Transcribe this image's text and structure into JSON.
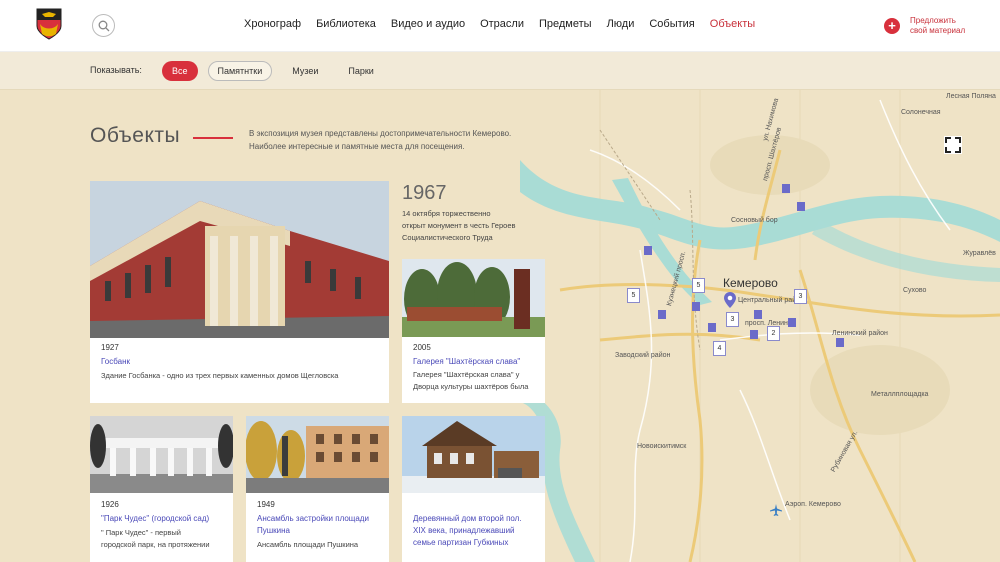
{
  "header": {
    "nav": [
      "Хронограф",
      "Библиотека",
      "Видео и аудио",
      "Отрасли",
      "Предметы",
      "Люди",
      "События",
      "Объекты"
    ],
    "active_nav": "Объекты",
    "suggest_line1": "Предложить",
    "suggest_line2": "свой материал"
  },
  "filters": {
    "label": "Показывать:",
    "items": [
      "Все",
      "Памятнтки",
      "Музеи",
      "Парки"
    ],
    "active": "Все"
  },
  "page": {
    "title": "Объекты",
    "intro_line1": "В экспозиция музея  представлены достопримечательности Кемерово.",
    "intro_line2": "Наиболее интересные и памятные места для посещения."
  },
  "feature": {
    "year": "1967",
    "desc_line1": "14 октября торжественно",
    "desc_line2": "открыт монумент в честь Героев",
    "desc_line3": "Социалистического Труда"
  },
  "cards": [
    {
      "year": "1927",
      "name": "Госбанк",
      "desc": "Здание Госбанка - одно из трех первых каменных домов Щегловска"
    },
    {
      "year": "2005",
      "name": "Галерея \"Шахтёрская слава\"",
      "desc_line1": "Галерея \"Шахтёрская слава\" у",
      "desc_line2": "Дворца культуры шахтёров была"
    },
    {
      "year": "1926",
      "name": "\"Парк Чудес\" (городской сад)",
      "desc_line1": "\" Парк Чудес\" - первый",
      "desc_line2": "городской парк, на протяжении"
    },
    {
      "year": "1949",
      "name_line1": "Ансамбль застройки площади",
      "name_line2": "Пушкина",
      "desc": "Ансамбль площади Пушкина"
    },
    {
      "name_line1": "Деревянный дом второй пол.",
      "name_line2": "XIX века, принадлежавший",
      "name_line3": "семье партизан Губкиных"
    }
  ],
  "map": {
    "city": "Кемерово",
    "labels": {
      "lesnaya_polyana": "Лесная Поляна",
      "solonechnaya": "Солонечная",
      "sosnovy_bor": "Сосновый бор",
      "zhuravlevo": "Журавлёв",
      "sukhovo": "Сухово",
      "leninsky": "Ленинский район",
      "zavodsky": "Заводский район",
      "central": "Центральный район",
      "metallploshchadka": "Металлплощадка",
      "novoiskitimsk": "Новоискитимск",
      "pr_lenina": "просп. Ленина",
      "kuznetsky": "Кузнецкий просп.",
      "pr_shakhterov": "просп. Шахтёров",
      "ul_nakhimova": "ул. Нахимова",
      "rubinovaya": "Рубиновая ул.",
      "pr_kemerovo": "Аэроп. Кемерово"
    },
    "clusters": [
      "5",
      "5",
      "3",
      "3",
      "2",
      "4"
    ]
  },
  "colors": {
    "accent": "#d8303c",
    "link": "#4a49b8",
    "marker": "#6b6bc9",
    "river": "#a9dcd5",
    "land": "#efe3c6"
  }
}
